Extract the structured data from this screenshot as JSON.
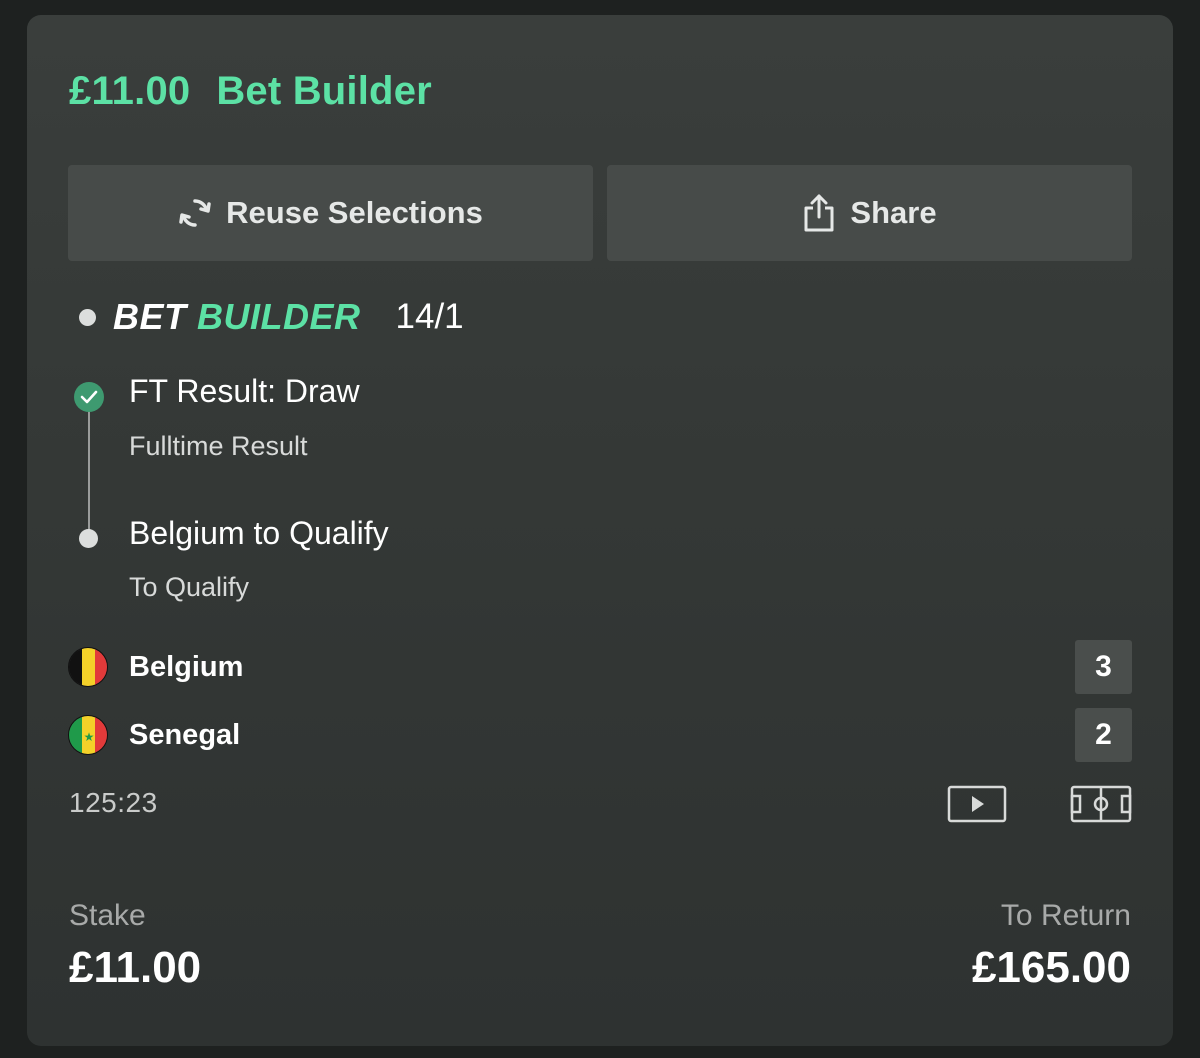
{
  "header": {
    "stake_amount": "£11.00",
    "bet_type": "Bet Builder"
  },
  "actions": {
    "reuse_label": "Reuse Selections",
    "share_label": "Share"
  },
  "bet_builder": {
    "logo_part1": "BET",
    "logo_part2": "BUILDER",
    "odds": "14/1"
  },
  "selections": [
    {
      "title": "FT Result: Draw",
      "market": "Fulltime Result",
      "status": "won"
    },
    {
      "title": "Belgium to Qualify",
      "market": "To Qualify",
      "status": "pending"
    }
  ],
  "match": {
    "teams": [
      {
        "name": "Belgium",
        "score": "3",
        "flag": "belgium-flag-icon"
      },
      {
        "name": "Senegal",
        "score": "2",
        "flag": "senegal-flag-icon"
      }
    ],
    "clock": "125:23"
  },
  "footer": {
    "stake_label": "Stake",
    "stake_value": "£11.00",
    "return_label": "To Return",
    "return_value": "£165.00"
  },
  "colors": {
    "accent": "#5ce1a5",
    "card_bg": "#373b39",
    "button_bg": "#474b49",
    "won_check": "#3e9a70"
  }
}
